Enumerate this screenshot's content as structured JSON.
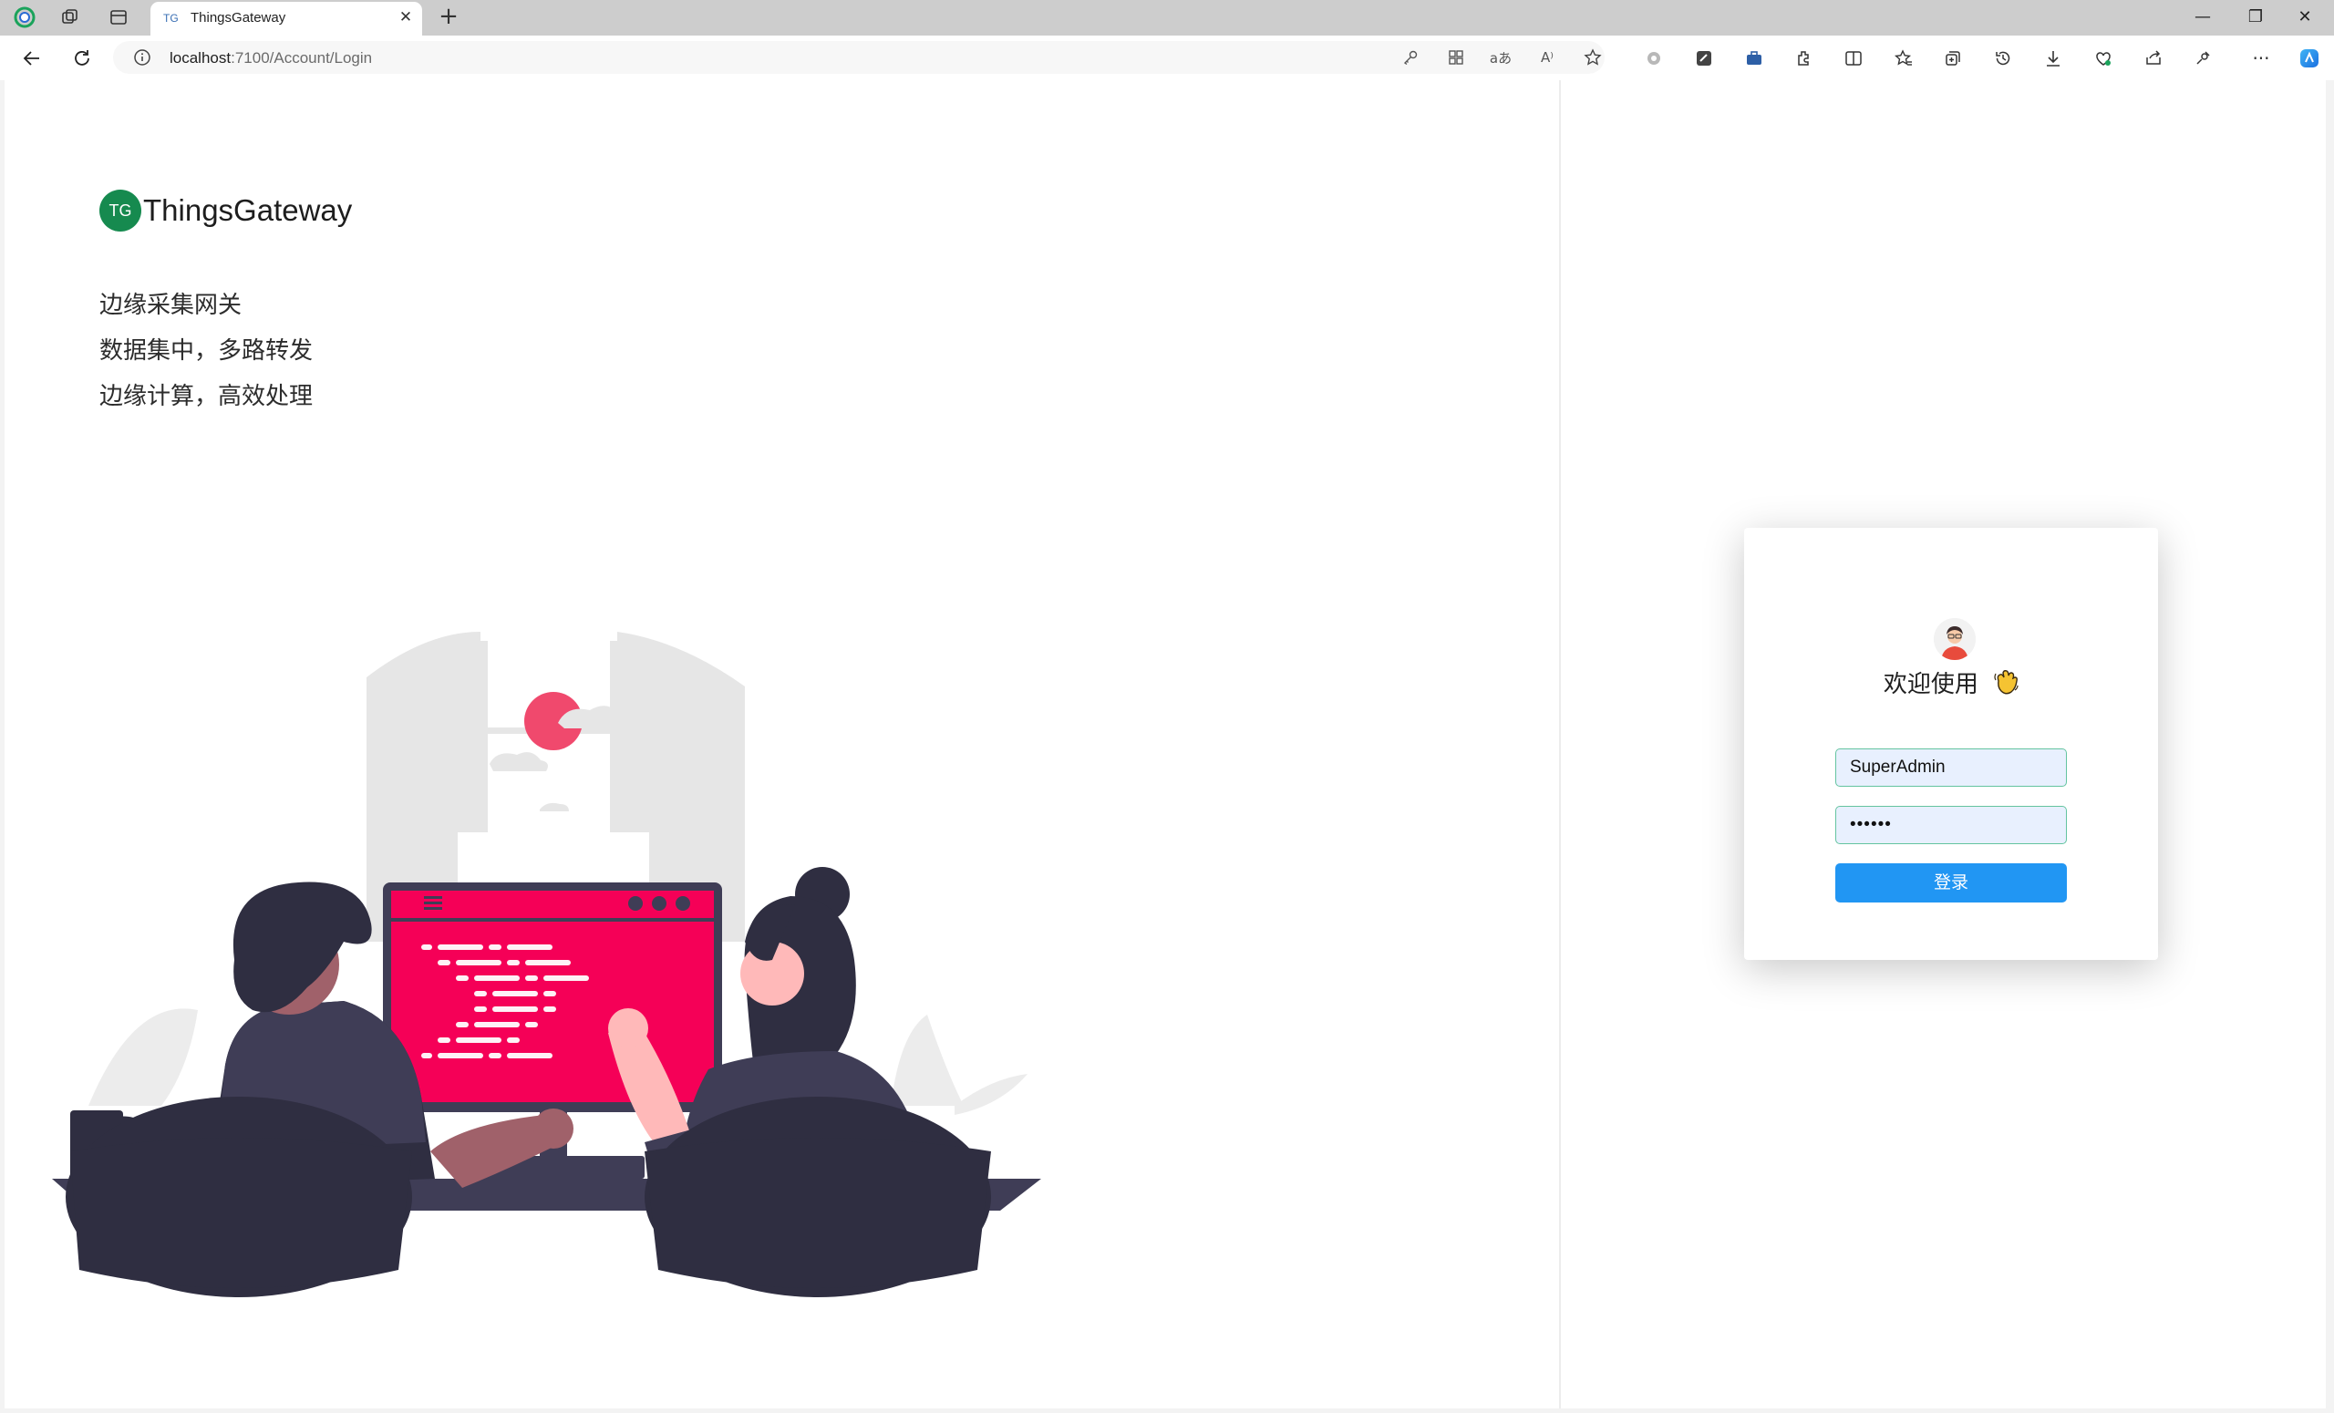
{
  "browser": {
    "tab_favicon": "TG",
    "tab_title": "ThingsGateway",
    "tab_close": "✕",
    "new_tab": "+",
    "address_host": "localhost",
    "address_path": ":7100/Account/Login",
    "window_controls": [
      "—",
      "❐",
      "✕"
    ],
    "icons": [
      "back-icon",
      "refresh-icon",
      "info-icon",
      "key-icon",
      "app-grid-icon",
      "translate-icon",
      "read-aloud-icon",
      "favorite-star-icon",
      "extension-icon",
      "collections-icon",
      "split-screen-icon",
      "favorites-icon",
      "history-icon",
      "download-icon",
      "performance-icon",
      "share-icon",
      "settings-icon",
      "more-icon",
      "copilot-icon"
    ]
  },
  "brand": {
    "logo_text": "TG",
    "name": "ThingsGateway",
    "color": "#168a4f"
  },
  "slogans": [
    "边缘采集网关",
    "数据集中，多路转发",
    "边缘计算，高效处理"
  ],
  "login": {
    "welcome": "欢迎使用",
    "username": "SuperAdmin",
    "password_mask": "••••••",
    "submit_label": "登录",
    "button_color": "#2196f3"
  }
}
